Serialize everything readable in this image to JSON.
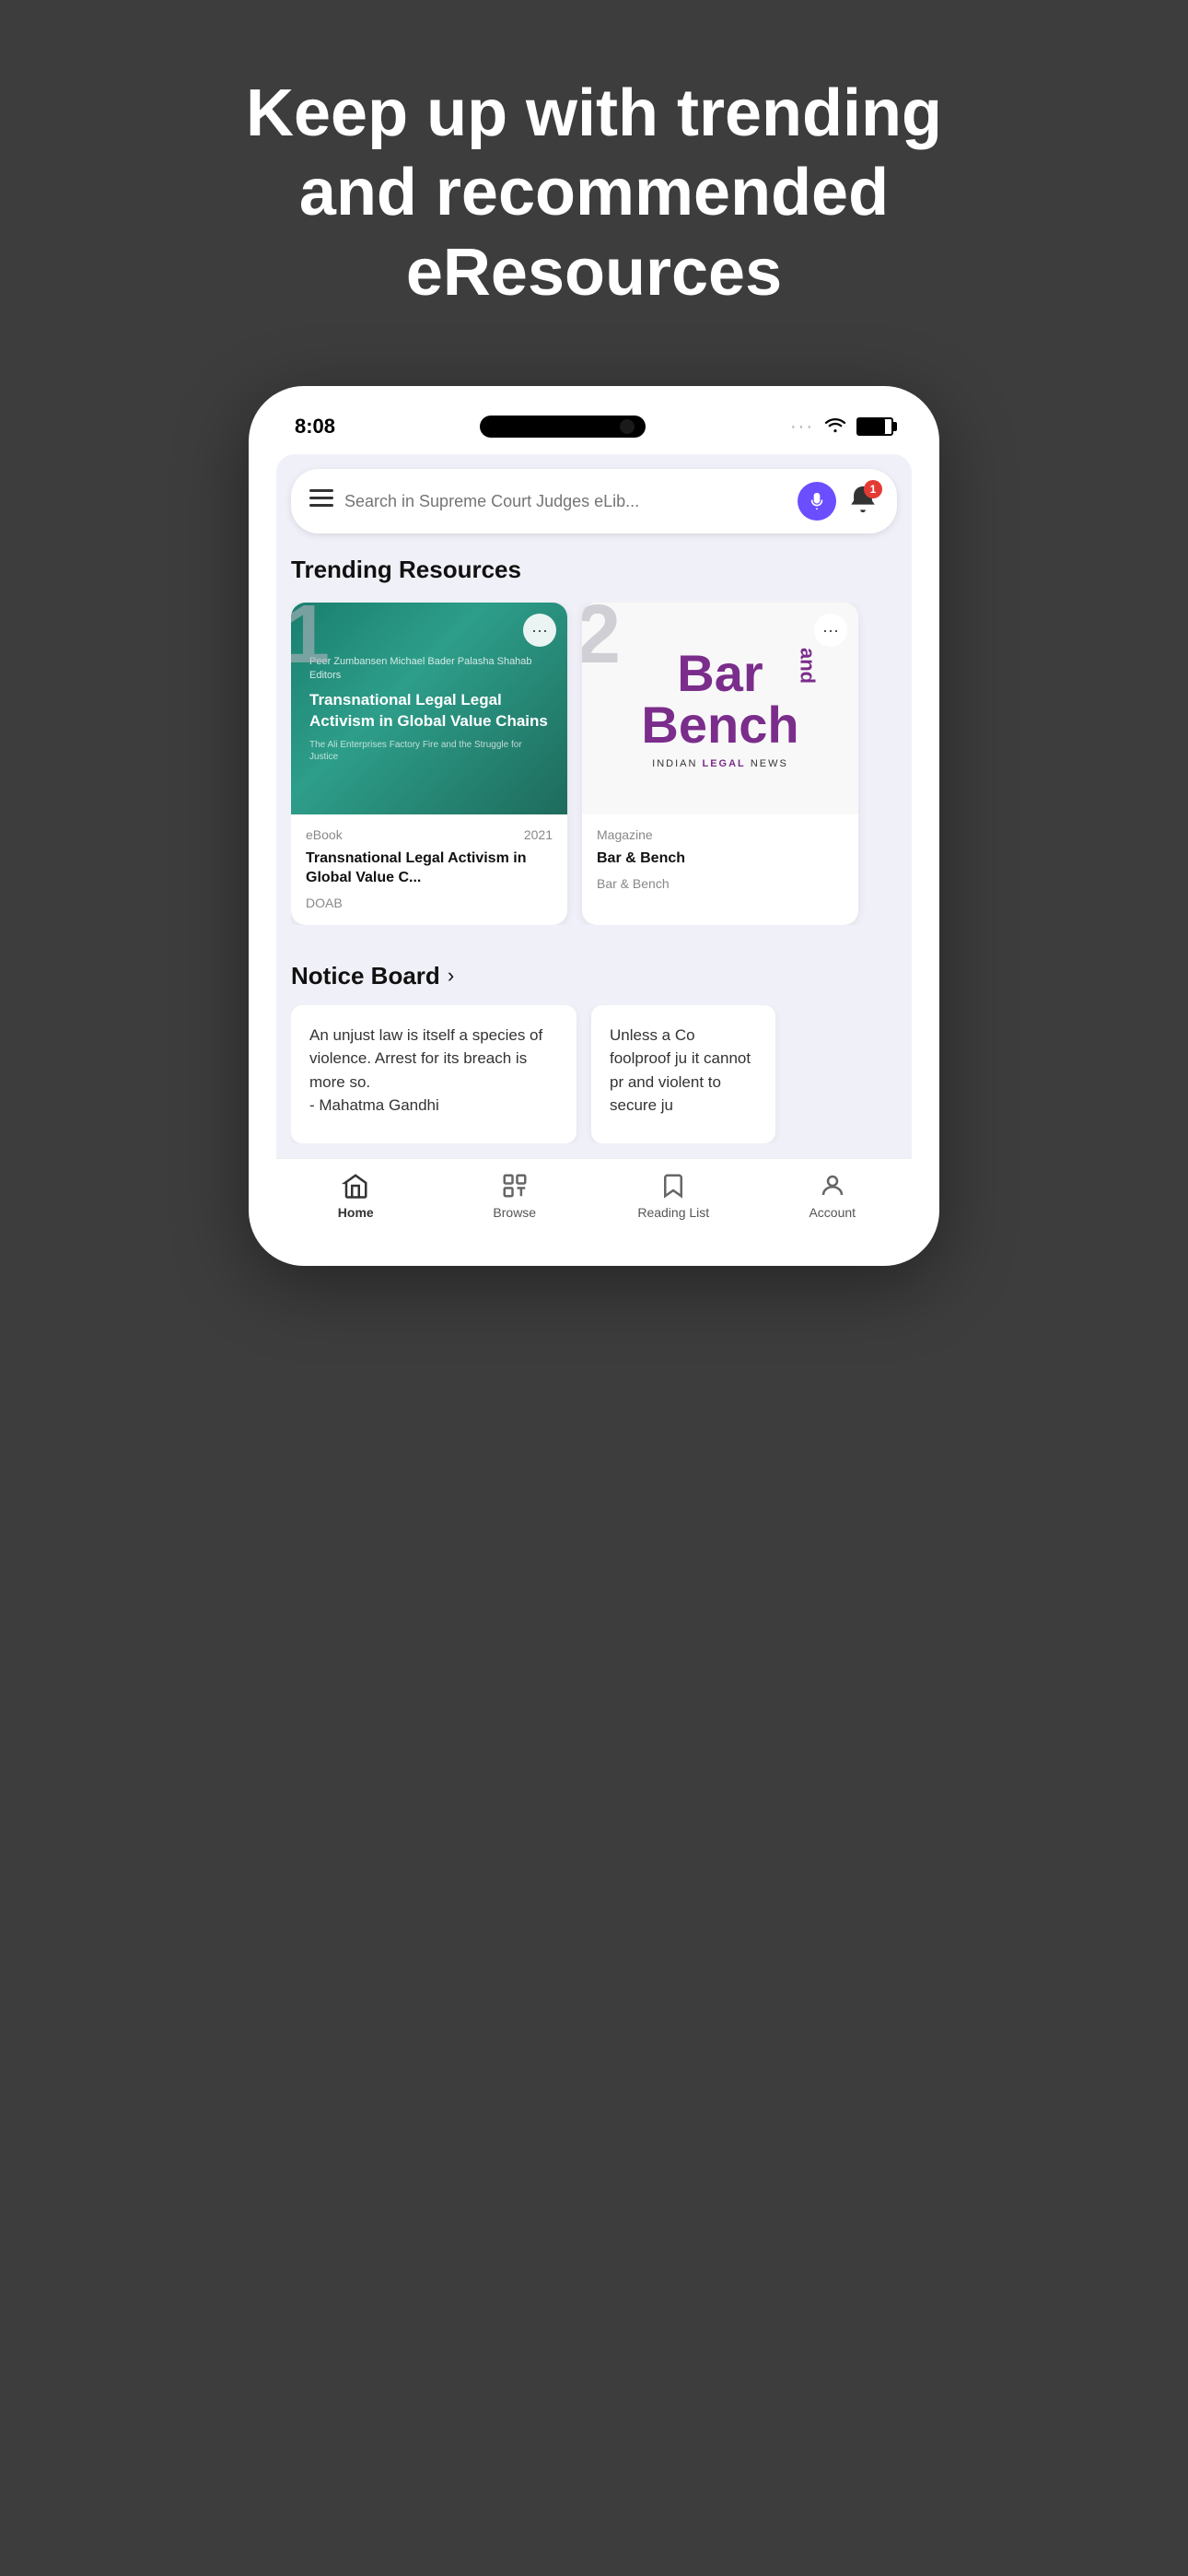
{
  "hero": {
    "headline": "Keep up with trending and recommended eResources"
  },
  "phone": {
    "time": "8:08",
    "search_placeholder": "Search in Supreme Court Judges eLib...",
    "notification_count": "1"
  },
  "trending": {
    "title": "Trending Resources",
    "cards": [
      {
        "number": "1",
        "type": "eBook",
        "year": "2021",
        "authors": "Peer Zumbansen\nMichael Bader\nPalasha Shahab  Editors",
        "title": "Transnational Legal Activism in Global Value C...",
        "full_title": "Transnational Legal\nLegal Activism\nin Global Value\nChains",
        "subtitle": "The Ali Enterprises Factory Fire and\nthe Struggle for Justice",
        "author_label": "DOAB"
      },
      {
        "number": "2",
        "type": "Magazine",
        "year": "",
        "title": "Bar & Bench",
        "author_label": "Bar & Bench",
        "logo_line1": "Bar",
        "logo_line2": "Bench",
        "logo_and": "and",
        "tagline": "INDIAN LEGAL NEWS"
      }
    ]
  },
  "notice_board": {
    "title": "Notice Board",
    "cards": [
      {
        "text": "An unjust law is itself a species of violence. Arrest for its breach is more so.\n- Mahatma Gandhi"
      },
      {
        "text": "Unless a Co foolproof ju it cannot pr and violent to secure ju"
      }
    ]
  },
  "bottom_nav": {
    "items": [
      {
        "label": "Home",
        "icon": "home-icon",
        "active": true
      },
      {
        "label": "Browse",
        "icon": "browse-icon",
        "active": false
      },
      {
        "label": "Reading List",
        "icon": "reading-list-icon",
        "active": false
      },
      {
        "label": "Account",
        "icon": "account-icon",
        "active": false
      }
    ]
  }
}
